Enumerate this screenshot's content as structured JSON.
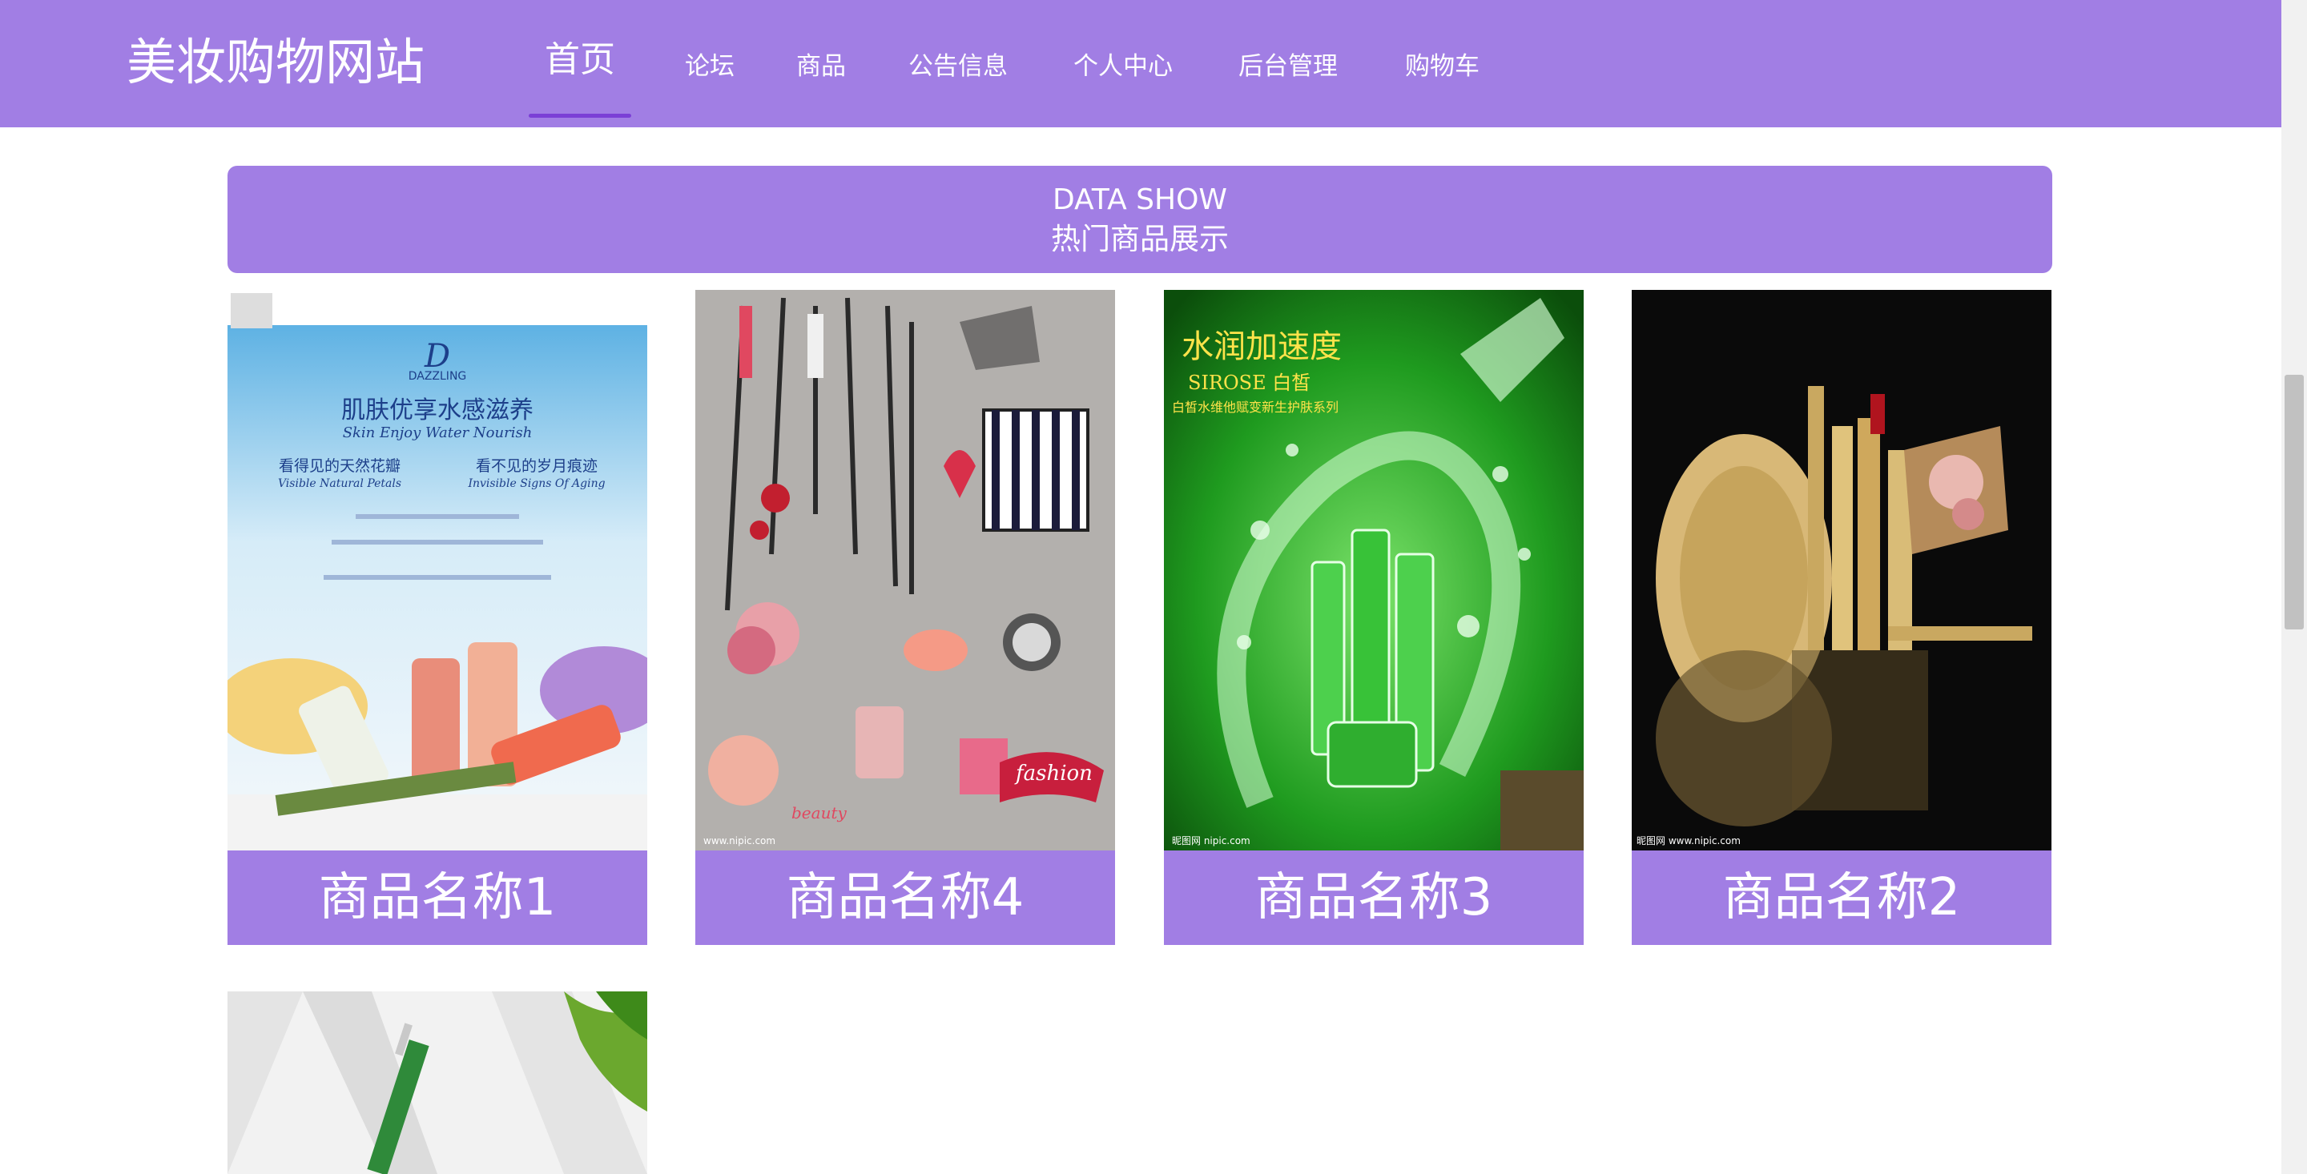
{
  "header": {
    "site_title": "美妆购物网站",
    "nav": [
      {
        "label": "首页",
        "active": true
      },
      {
        "label": "论坛"
      },
      {
        "label": "商品"
      },
      {
        "label": "公告信息"
      },
      {
        "label": "个人中心"
      },
      {
        "label": "后台管理"
      },
      {
        "label": "购物车"
      }
    ]
  },
  "banner": {
    "title_en": "DATA SHOW",
    "title_cn": "热门商品展示"
  },
  "products": [
    {
      "name": "商品名称1",
      "image": {
        "brand": "DAZZLING",
        "headline": "肌肤优享水感滋养",
        "subline": "Skin Enjoy Water Nourish",
        "left_text": "看得见的天然花瓣",
        "right_text": "看不见的岁月痕迹",
        "left_en": "Visible Natural Petals",
        "right_en": "Invisible Signs Of Aging"
      }
    },
    {
      "name": "商品名称4",
      "image": {
        "script_text": "fashion",
        "beauty_text": "beauty",
        "watermark": "www.nipic.com"
      }
    },
    {
      "name": "商品名称3",
      "image": {
        "headline": "水润加速度",
        "brand_line": "SIROSE 白皙",
        "subline": "白皙水维他赋变新生护肤系列",
        "watermark": "昵图网 nipic.com"
      }
    },
    {
      "name": "商品名称2",
      "image": {
        "watermark": "昵图网 www.nipic.com"
      }
    },
    {
      "name": "",
      "image": {}
    }
  ],
  "colors": {
    "accent": "#a17ee4",
    "underline": "#7b3fd6"
  }
}
